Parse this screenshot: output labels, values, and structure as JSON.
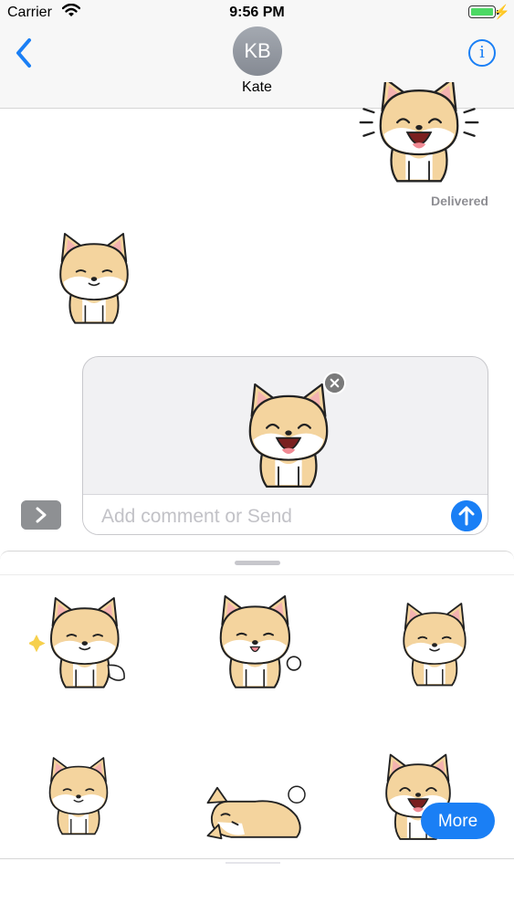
{
  "status_bar": {
    "carrier": "Carrier",
    "time": "9:56 PM"
  },
  "header": {
    "avatar_initials": "KB",
    "contact_name": "Kate"
  },
  "conversation": {
    "delivered_label": "Delivered"
  },
  "compose": {
    "placeholder": "Add comment or Send"
  },
  "sticker_drawer": {
    "more_label": "More"
  },
  "colors": {
    "accent": "#1a7ff5",
    "fur": "#f4d49e",
    "fur_outline": "#222222",
    "ear_pink": "#f4b2b0",
    "battery": "#4cd964"
  }
}
